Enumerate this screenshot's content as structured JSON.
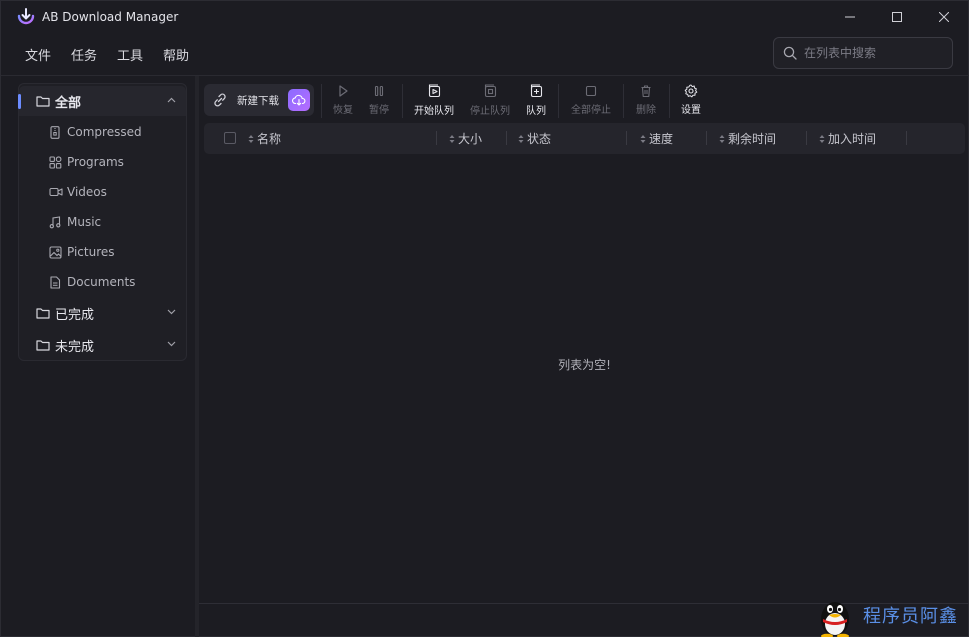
{
  "app": {
    "title": "AB Download Manager",
    "accent": "#6c8cff",
    "logo_icon": "download-logo-icon"
  },
  "window_controls": {
    "minimize_icon": "minimize-icon",
    "maximize_icon": "maximize-icon",
    "close_icon": "close-icon"
  },
  "menu": {
    "items": [
      {
        "label": "文件"
      },
      {
        "label": "任务"
      },
      {
        "label": "工具"
      },
      {
        "label": "帮助"
      }
    ]
  },
  "search": {
    "placeholder": "在列表中搜索",
    "value": "",
    "icon": "search-icon"
  },
  "sidebar": {
    "categories": [
      {
        "label": "全部",
        "icon": "folder-icon",
        "expanded": true,
        "active": true
      },
      {
        "label": "已完成",
        "icon": "folder-icon",
        "expanded": false
      },
      {
        "label": "未完成",
        "icon": "folder-icon",
        "expanded": false
      }
    ],
    "subcategories": [
      {
        "label": "Compressed",
        "icon": "archive-icon"
      },
      {
        "label": "Programs",
        "icon": "apps-icon"
      },
      {
        "label": "Videos",
        "icon": "video-icon"
      },
      {
        "label": "Music",
        "icon": "music-icon"
      },
      {
        "label": "Pictures",
        "icon": "image-icon"
      },
      {
        "label": "Documents",
        "icon": "document-icon"
      }
    ]
  },
  "toolbar": {
    "new_download_label": "新建下载",
    "buttons": [
      {
        "label": "恢复",
        "icon": "play-icon",
        "enabled": false
      },
      {
        "label": "暂停",
        "icon": "pause-icon",
        "enabled": false
      },
      {
        "label": "开始队列",
        "icon": "start-queue-icon",
        "enabled": true
      },
      {
        "label": "停止队列",
        "icon": "stop-queue-icon",
        "enabled": false
      },
      {
        "label": "队列",
        "icon": "queue-icon",
        "enabled": true
      },
      {
        "label": "全部停止",
        "icon": "stop-icon",
        "enabled": false
      },
      {
        "label": "删除",
        "icon": "trash-icon",
        "enabled": false
      },
      {
        "label": "设置",
        "icon": "gear-icon",
        "enabled": true
      }
    ]
  },
  "table": {
    "columns": [
      {
        "label": "名称"
      },
      {
        "label": "大小"
      },
      {
        "label": "状态"
      },
      {
        "label": "速度"
      },
      {
        "label": "剩余时间"
      },
      {
        "label": "加入时间"
      }
    ],
    "rows": [],
    "empty_message": "列表为空!"
  },
  "watermark": {
    "text": "程序员阿鑫"
  }
}
